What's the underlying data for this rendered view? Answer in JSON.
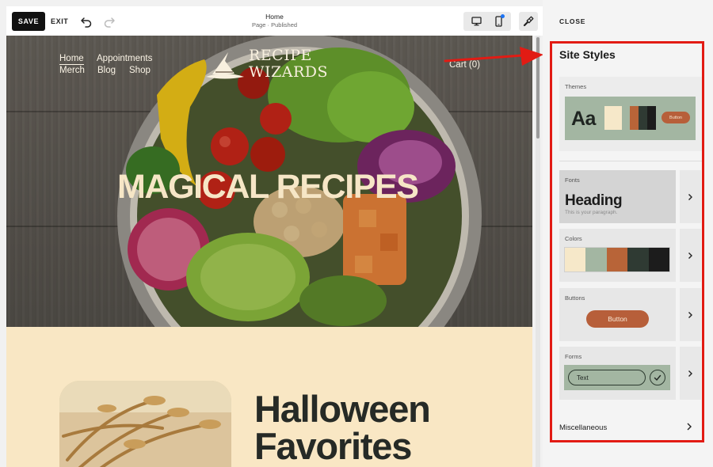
{
  "toolbar": {
    "save_label": "SAVE",
    "exit_label": "EXIT",
    "page_title": "Home",
    "page_status": "Page · Published",
    "undo_icon": "undo-icon",
    "redo_icon": "redo-icon",
    "desktop_icon": "desktop-icon",
    "mobile_icon": "mobile-icon",
    "brush_icon": "paint-brush-icon",
    "accent": "#1d74f5"
  },
  "site": {
    "nav": {
      "home": "Home",
      "appointments": "Appointments",
      "merch": "Merch",
      "blog": "Blog",
      "shop": "Shop"
    },
    "logo_line1": "RECIPE",
    "logo_line2": "WIZARDS",
    "cart": "Cart (0)",
    "hero_title": "MAGICAL RECIPES",
    "section_heading_line1": "Halloween",
    "section_heading_line2": "Favorites"
  },
  "panel": {
    "close_label": "CLOSE",
    "title": "Site Styles",
    "highlight_color": "#e21b14",
    "themes": {
      "label": "Themes",
      "sample_text": "Aa",
      "button_text": "Button",
      "swatches": [
        "#f6e8c9",
        "#b86438",
        "#2f3a33",
        "#1c1c1c"
      ]
    },
    "fonts": {
      "label": "Fonts",
      "heading_sample": "Heading",
      "paragraph_sample": "This is your paragraph."
    },
    "colors": {
      "label": "Colors",
      "swatches": [
        "#f6e8c9",
        "#a3b6a2",
        "#b86438",
        "#2f3a33",
        "#1c1c1c"
      ]
    },
    "buttons": {
      "label": "Buttons",
      "button_text": "Button"
    },
    "forms": {
      "label": "Forms",
      "field_text": "Text"
    },
    "misc_label": "Miscellaneous"
  }
}
